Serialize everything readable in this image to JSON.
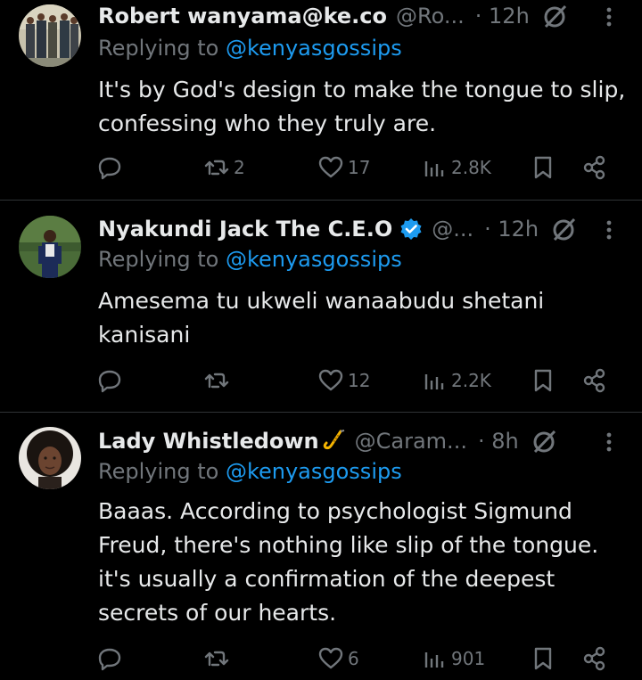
{
  "colors": {
    "background": "#000000",
    "text_primary": "#e7e9ea",
    "text_secondary": "#71767b",
    "accent_link": "#1d9bf0",
    "divider": "#2f3336"
  },
  "replies": [
    {
      "display_name": "Robert wanyama@ke.co",
      "handle": "@Ro...",
      "time": "· 12h",
      "replying_label": "Replying to",
      "replying_to": "@kenyasgossips",
      "text": "It's by God's design to make the tongue to slip, confessing who they truly are.",
      "retweets": "2",
      "likes": "17",
      "views": "2.8K"
    },
    {
      "display_name": "Nyakundi Jack The C.E.O",
      "verified_icon": "verified-badge-icon",
      "handle": "@...",
      "time": "· 12h",
      "replying_label": "Replying to",
      "replying_to": "@kenyasgossips",
      "text": "Amesema tu ukweli wanaabudu shetani kanisani",
      "retweets": "",
      "likes": "12",
      "views": "2.2K"
    },
    {
      "display_name": "Lady Whistledown",
      "name_emoji_icon": "saxophone-icon",
      "handle": "@Caram...",
      "time": "· 8h",
      "replying_label": "Replying to",
      "replying_to": "@kenyasgossips",
      "text": "Baaas. According to psychologist Sigmund Freud, there's nothing like slip of the tongue. it's usually a confirmation of the deepest secrets of our hearts.",
      "retweets": "",
      "likes": "6",
      "views": "901"
    }
  ]
}
